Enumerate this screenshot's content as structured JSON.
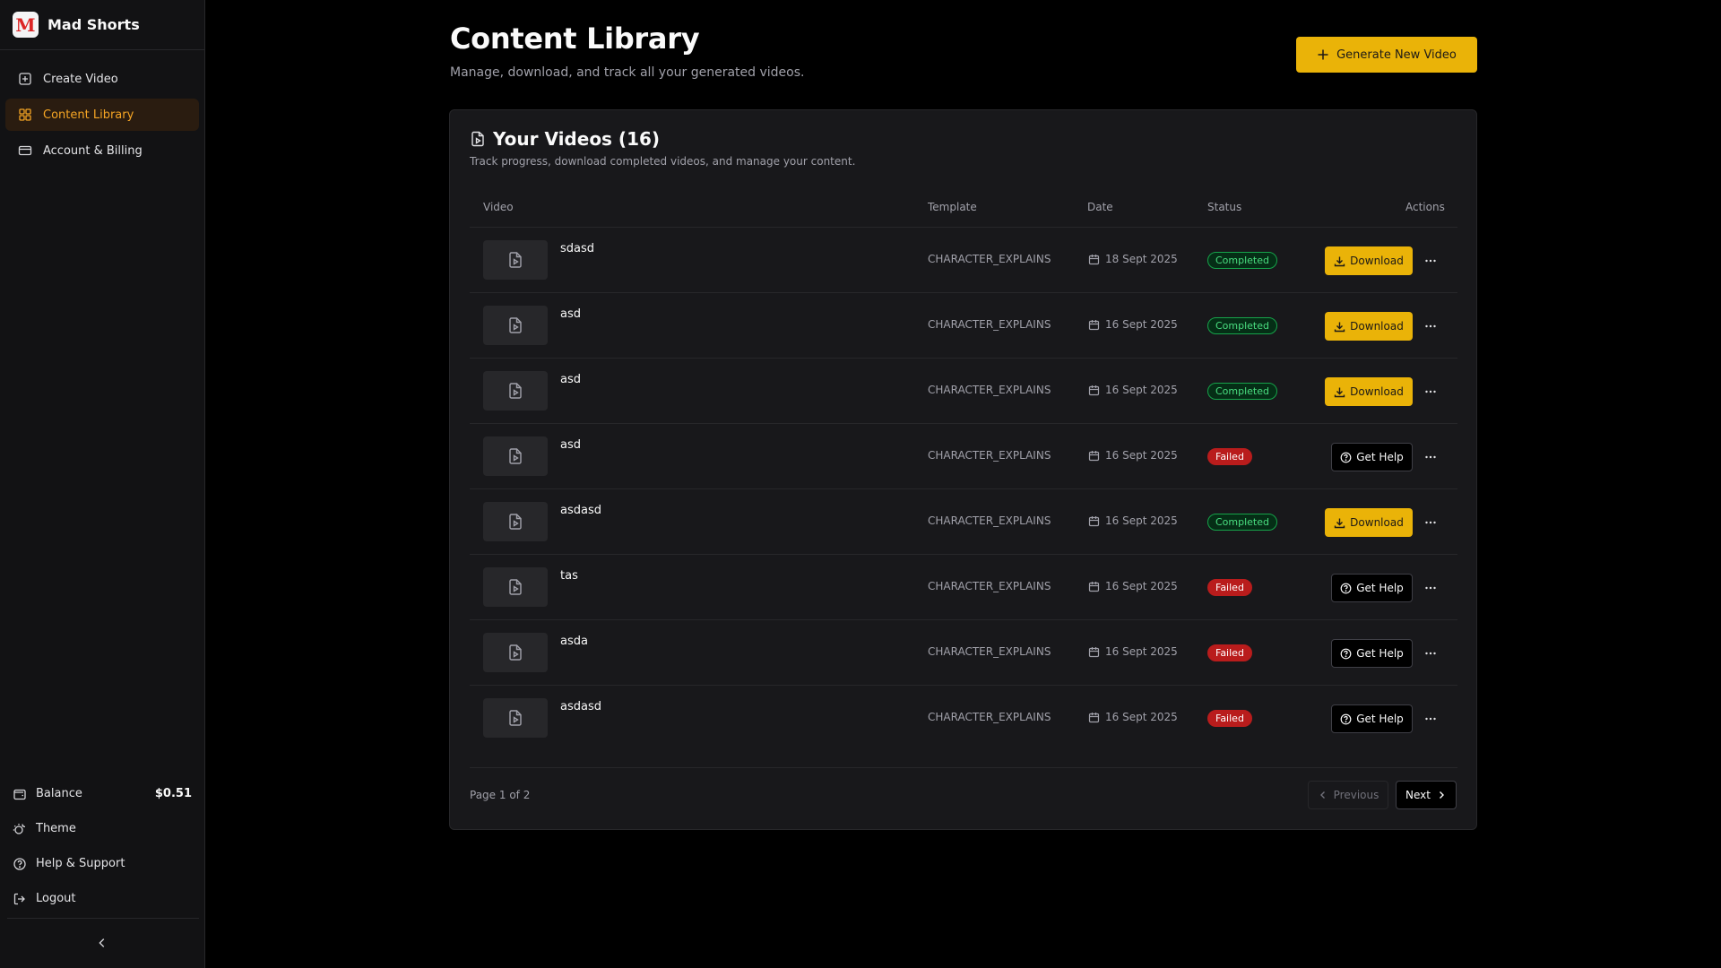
{
  "brand": {
    "logo_letter": "M",
    "name": "Mad Shorts"
  },
  "nav": [
    {
      "label": "Create Video",
      "icon": "plus-square-icon",
      "active": false
    },
    {
      "label": "Content Library",
      "icon": "grid-icon",
      "active": true
    },
    {
      "label": "Account & Billing",
      "icon": "credit-card-icon",
      "active": false
    }
  ],
  "sidebar_bottom": {
    "balance_label": "Balance",
    "balance_value": "$0.51",
    "theme_label": "Theme",
    "help_label": "Help & Support",
    "logout_label": "Logout"
  },
  "header": {
    "title": "Content Library",
    "subtitle": "Manage, download, and track all your generated videos.",
    "generate_label": "Generate New Video"
  },
  "card": {
    "title": "Your Videos (16)",
    "subtitle": "Track progress, download completed videos, and manage your content."
  },
  "columns": {
    "video": "Video",
    "template": "Template",
    "date": "Date",
    "status": "Status",
    "actions": "Actions"
  },
  "videos": [
    {
      "name": "sdasd",
      "template": "CHARACTER_EXPLAINS",
      "date": "18 Sept 2025",
      "status": "Completed",
      "action": "Download"
    },
    {
      "name": "asd",
      "template": "CHARACTER_EXPLAINS",
      "date": "16 Sept 2025",
      "status": "Completed",
      "action": "Download"
    },
    {
      "name": "asd",
      "template": "CHARACTER_EXPLAINS",
      "date": "16 Sept 2025",
      "status": "Completed",
      "action": "Download"
    },
    {
      "name": "asd",
      "template": "CHARACTER_EXPLAINS",
      "date": "16 Sept 2025",
      "status": "Failed",
      "action": "Get Help"
    },
    {
      "name": "asdasd",
      "template": "CHARACTER_EXPLAINS",
      "date": "16 Sept 2025",
      "status": "Completed",
      "action": "Download"
    },
    {
      "name": "tas",
      "template": "CHARACTER_EXPLAINS",
      "date": "16 Sept 2025",
      "status": "Failed",
      "action": "Get Help"
    },
    {
      "name": "asda",
      "template": "CHARACTER_EXPLAINS",
      "date": "16 Sept 2025",
      "status": "Failed",
      "action": "Get Help"
    },
    {
      "name": "asdasd",
      "template": "CHARACTER_EXPLAINS",
      "date": "16 Sept 2025",
      "status": "Failed",
      "action": "Get Help"
    }
  ],
  "pagination": {
    "info": "Page 1 of 2",
    "previous_label": "Previous",
    "next_label": "Next"
  },
  "colors": {
    "accent": "#eab308",
    "completed": "#4ade80",
    "failed": "#b91c1c",
    "active_nav": "#f5a524"
  }
}
